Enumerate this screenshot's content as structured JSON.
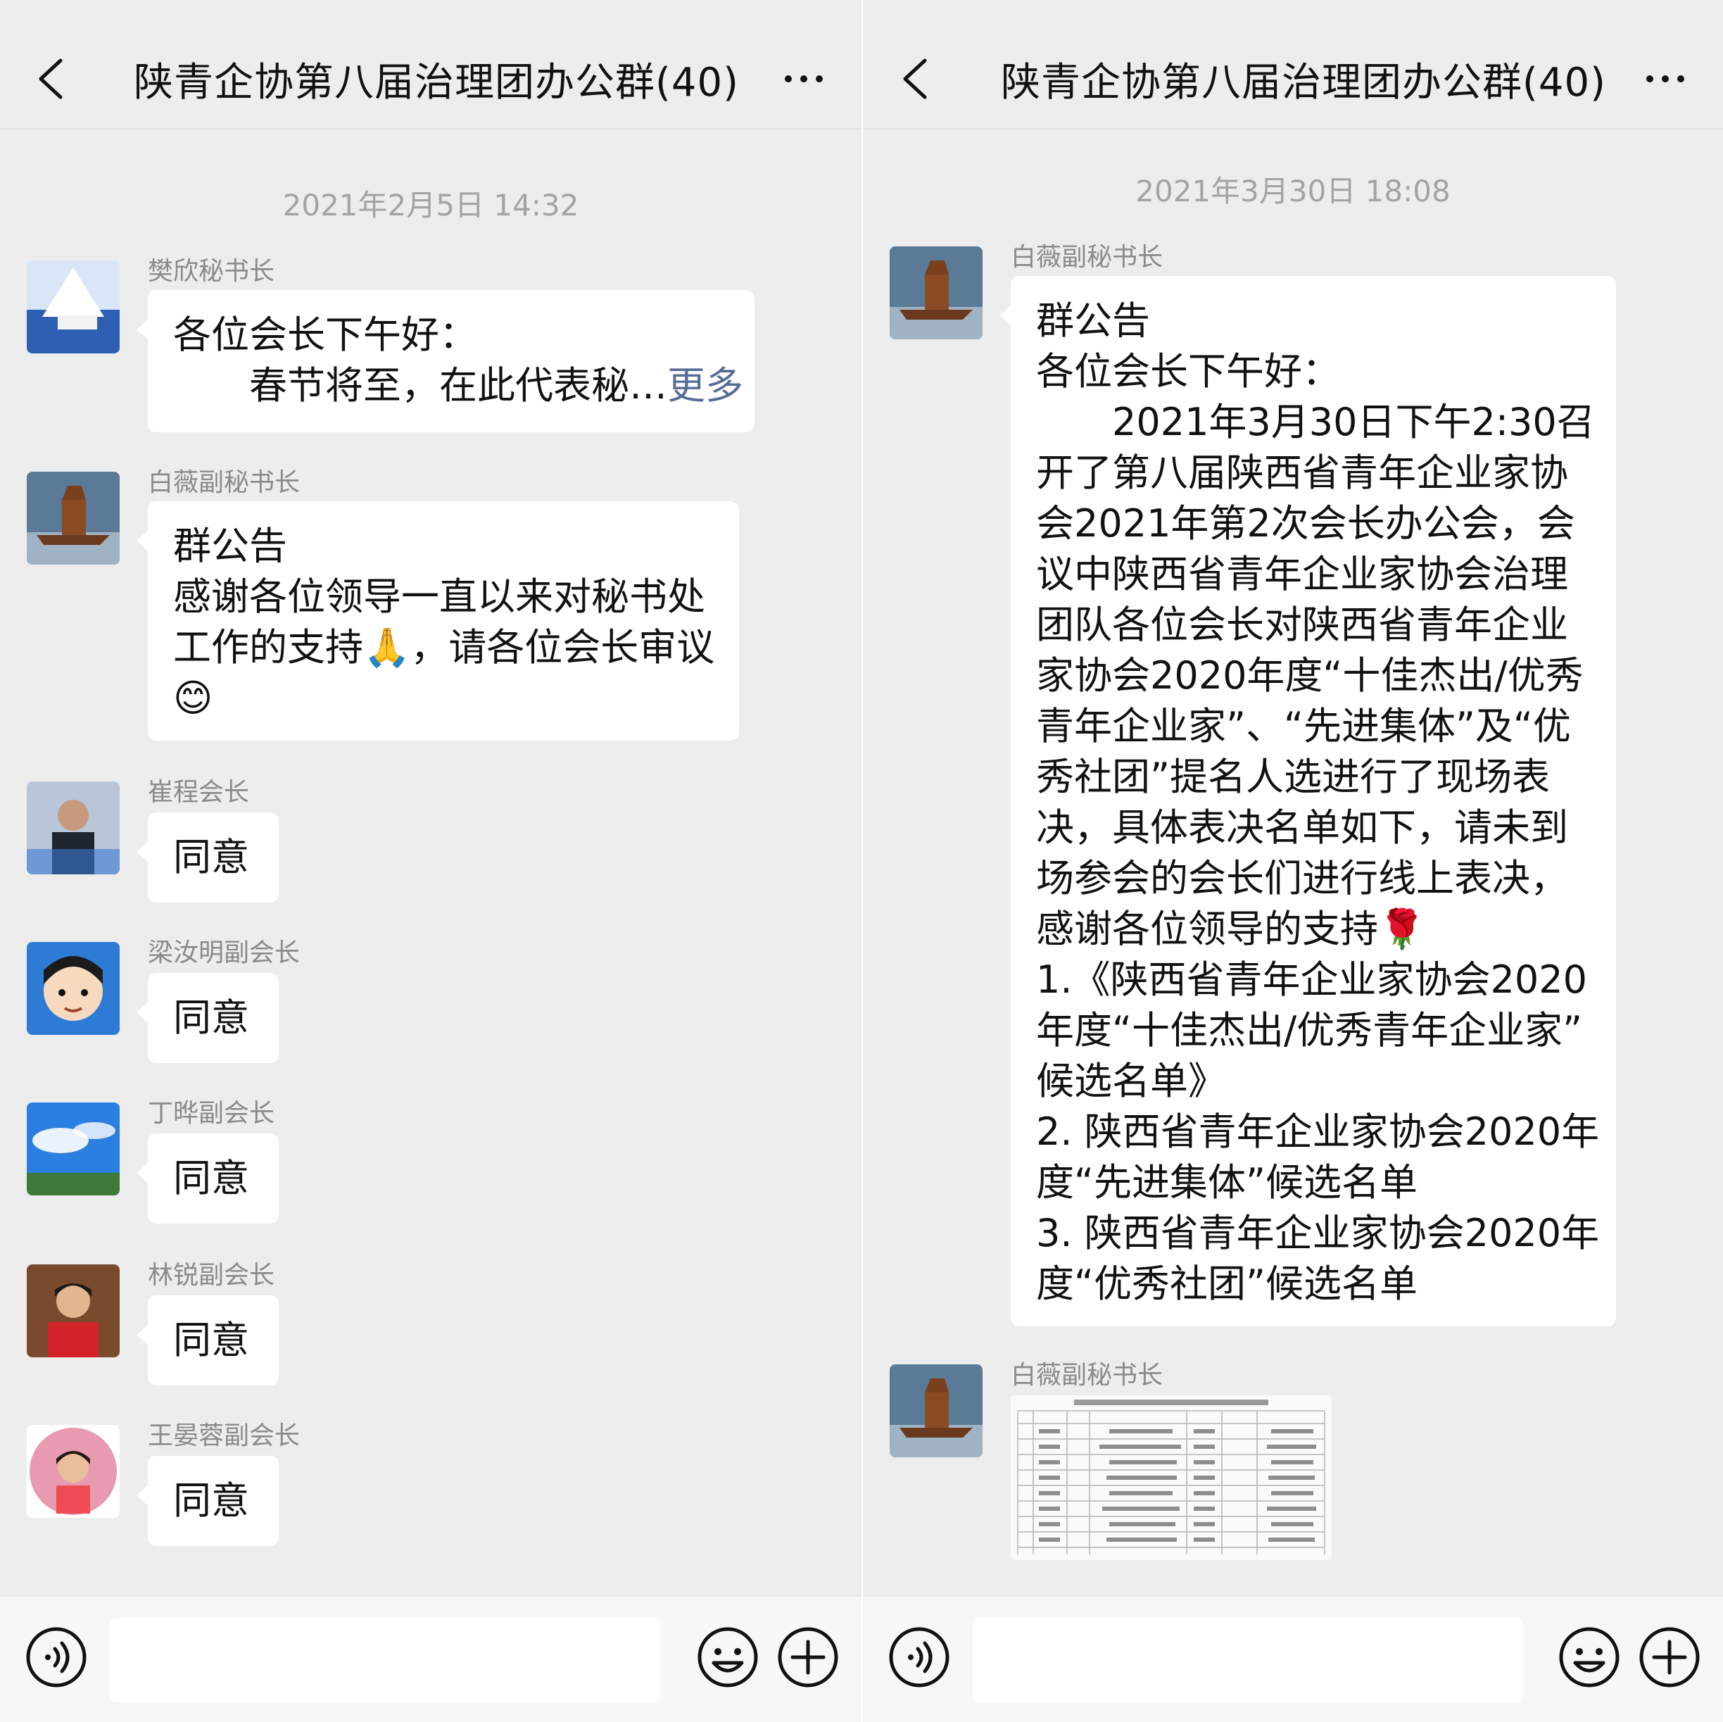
{
  "colors": {
    "background": "#ededed",
    "bubble": "#ffffff",
    "link": "#576b95",
    "timestamp": "#a3a3a3",
    "sender": "#8a8a8a"
  },
  "left": {
    "header": {
      "title": "陕青企协第八届治理团办公群(40)",
      "back_icon": "chevron-left-icon",
      "more_icon": "more-dots-icon"
    },
    "timestamp": "2021年2月5日 14:32",
    "messages": [
      {
        "sender": "樊欣秘书长",
        "avatar": "association-stage-avatar",
        "lines": [
          "各位会长下午好：",
          "　　春节将至，在此代表秘…"
        ],
        "more_link": "更多"
      },
      {
        "sender": "白薇副秘书长",
        "avatar": "ship-avatar",
        "lines": [
          "群公告",
          "感谢各位领导一直以来对秘书处",
          "工作的支持🙏，请各位会长审议",
          "😊"
        ]
      },
      {
        "sender": "崔程会长",
        "avatar": "crowd-photo-avatar",
        "lines": [
          "同意"
        ]
      },
      {
        "sender": "梁汝明副会长",
        "avatar": "cartoon-man-avatar",
        "lines": [
          "同意"
        ]
      },
      {
        "sender": "丁晔副会长",
        "avatar": "sky-landscape-avatar",
        "lines": [
          "同意"
        ]
      },
      {
        "sender": "林锐副会长",
        "avatar": "girl-photo-avatar",
        "lines": [
          "同意"
        ]
      },
      {
        "sender": "王晏蓉副会长",
        "avatar": "woman-flowers-avatar",
        "lines": [
          "同意"
        ]
      }
    ],
    "input": {
      "voice_icon": "voice-icon",
      "emoji_icon": "emoji-icon",
      "plus_icon": "plus-icon",
      "value": ""
    }
  },
  "right": {
    "header": {
      "title": "陕青企协第八届治理团办公群(40)",
      "back_icon": "chevron-left-icon",
      "more_icon": "more-dots-icon"
    },
    "timestamp": "2021年3月30日 18:08",
    "messages": [
      {
        "sender": "白薇副秘书长",
        "avatar": "ship-avatar",
        "lines": [
          "群公告",
          "各位会长下午好：",
          "　　2021年3月30日下午2:30召",
          "开了第八届陕西省青年企业家协",
          "会2021年第2次会长办公会，会",
          "议中陕西省青年企业家协会治理",
          "团队各位会长对陕西省青年企业",
          "家协会2020年度“十佳杰出/优秀",
          "青年企业家”、“先进集体”及“优",
          "秀社团”提名人选进行了现场表",
          "决，具体表决名单如下，请未到",
          "场参会的会长们进行线上表决，",
          "感谢各位领导的支持🌹",
          "1.《陕西省青年企业家协会2020",
          "年度“十佳杰出/优秀青年企业家”",
          "候选名单》",
          "2. 陕西省青年企业家协会2020年",
          "度“先进集体”候选名单",
          "3. 陕西省青年企业家协会2020年",
          "度“优秀社团”候选名单"
        ]
      },
      {
        "sender": "白薇副秘书长",
        "avatar": "ship-avatar",
        "attachment": "document-table-thumbnail"
      }
    ],
    "input": {
      "voice_icon": "voice-icon",
      "emoji_icon": "emoji-icon",
      "plus_icon": "plus-icon",
      "value": ""
    }
  }
}
